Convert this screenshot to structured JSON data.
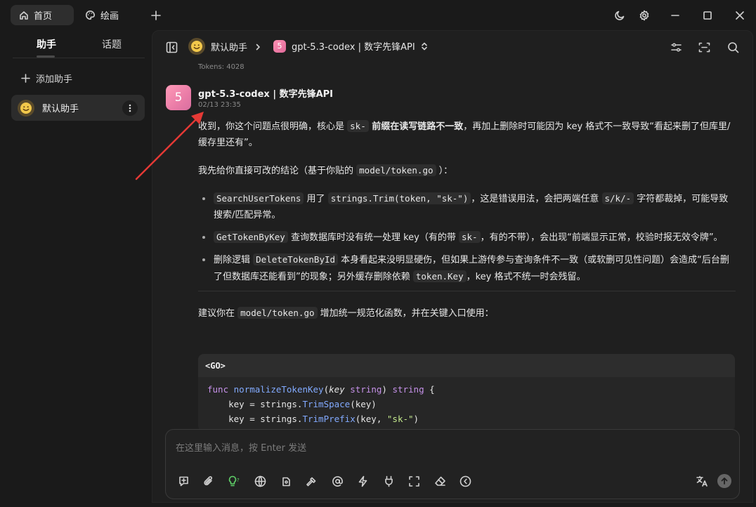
{
  "titlebar": {
    "tabs": [
      {
        "label": "首页",
        "icon": "home-icon",
        "active": true
      },
      {
        "label": "绘画",
        "icon": "palette-icon",
        "active": false
      }
    ]
  },
  "sidebar": {
    "tabs": [
      "助手",
      "话题"
    ],
    "add_label": "添加助手",
    "assistants": [
      {
        "name": "默认助手",
        "emoji": "😀"
      }
    ]
  },
  "header": {
    "assistant": "默认助手",
    "model_badge": "5",
    "model": "gpt-5.3-codex | 数字先锋API"
  },
  "chat": {
    "tokens": "Tokens: 4028",
    "sender": "gpt-5.3-codex | 数字先锋API",
    "avatar_text": "5",
    "timestamp": "02/13 23:35",
    "p1": {
      "a": "收到，你这个问题点很明确，核心是 ",
      "code": "sk-",
      "bold": " 前缀在读写链路不一致",
      "b": "，再加上删除时可能因为 key 格式不一致导致“看起来删了但库里/缓存里还有”。"
    },
    "p2": {
      "a": "我先给你直接可改的结论（基于你贴的 ",
      "code": "model/token.go",
      "b": " ）："
    },
    "bullets": [
      {
        "c1": "SearchUserTokens",
        "t1": " 用了 ",
        "c2": "strings.Trim(token, \"sk-\")",
        "t2": "，这是错误用法，会把两端任意 ",
        "c3": "s/k/-",
        "t3": " 字符都裁掉，可能导致搜索/匹配异常。"
      },
      {
        "c1": "GetTokenByKey",
        "t1": " 查询数据库时没有统一处理 key（有的带 ",
        "c2": "sk-",
        "t2": "，有的不带），会出现“前端显示正常，校验时报无效令牌”。"
      },
      {
        "t0": "删除逻辑 ",
        "c1": "DeleteTokenById",
        "t1": " 本身看起来没明显硬伤，但如果上游传参与查询条件不一致（或软删可见性问题）会造成“后台删了但数据库还能看到”的现象；另外缓存删除依赖 ",
        "c2": "token.Key",
        "t2": "，key 格式不统一时会残留。"
      }
    ],
    "p3": {
      "a": "建议你在 ",
      "code": "model/token.go",
      "b": " 增加统一规范化函数，并在关键入口使用："
    },
    "code_lang": "<GO>",
    "code_lines": [
      "func normalizeTokenKey(key string) string {",
      "    key = strings.TrimSpace(key)",
      "    key = strings.TrimPrefix(key, \"sk-\")"
    ]
  },
  "input": {
    "placeholder": "在这里输入消息，按 Enter 发送"
  },
  "colors": {
    "accent_pink": "#ea7ca7",
    "annotation_arrow": "#e53935"
  }
}
